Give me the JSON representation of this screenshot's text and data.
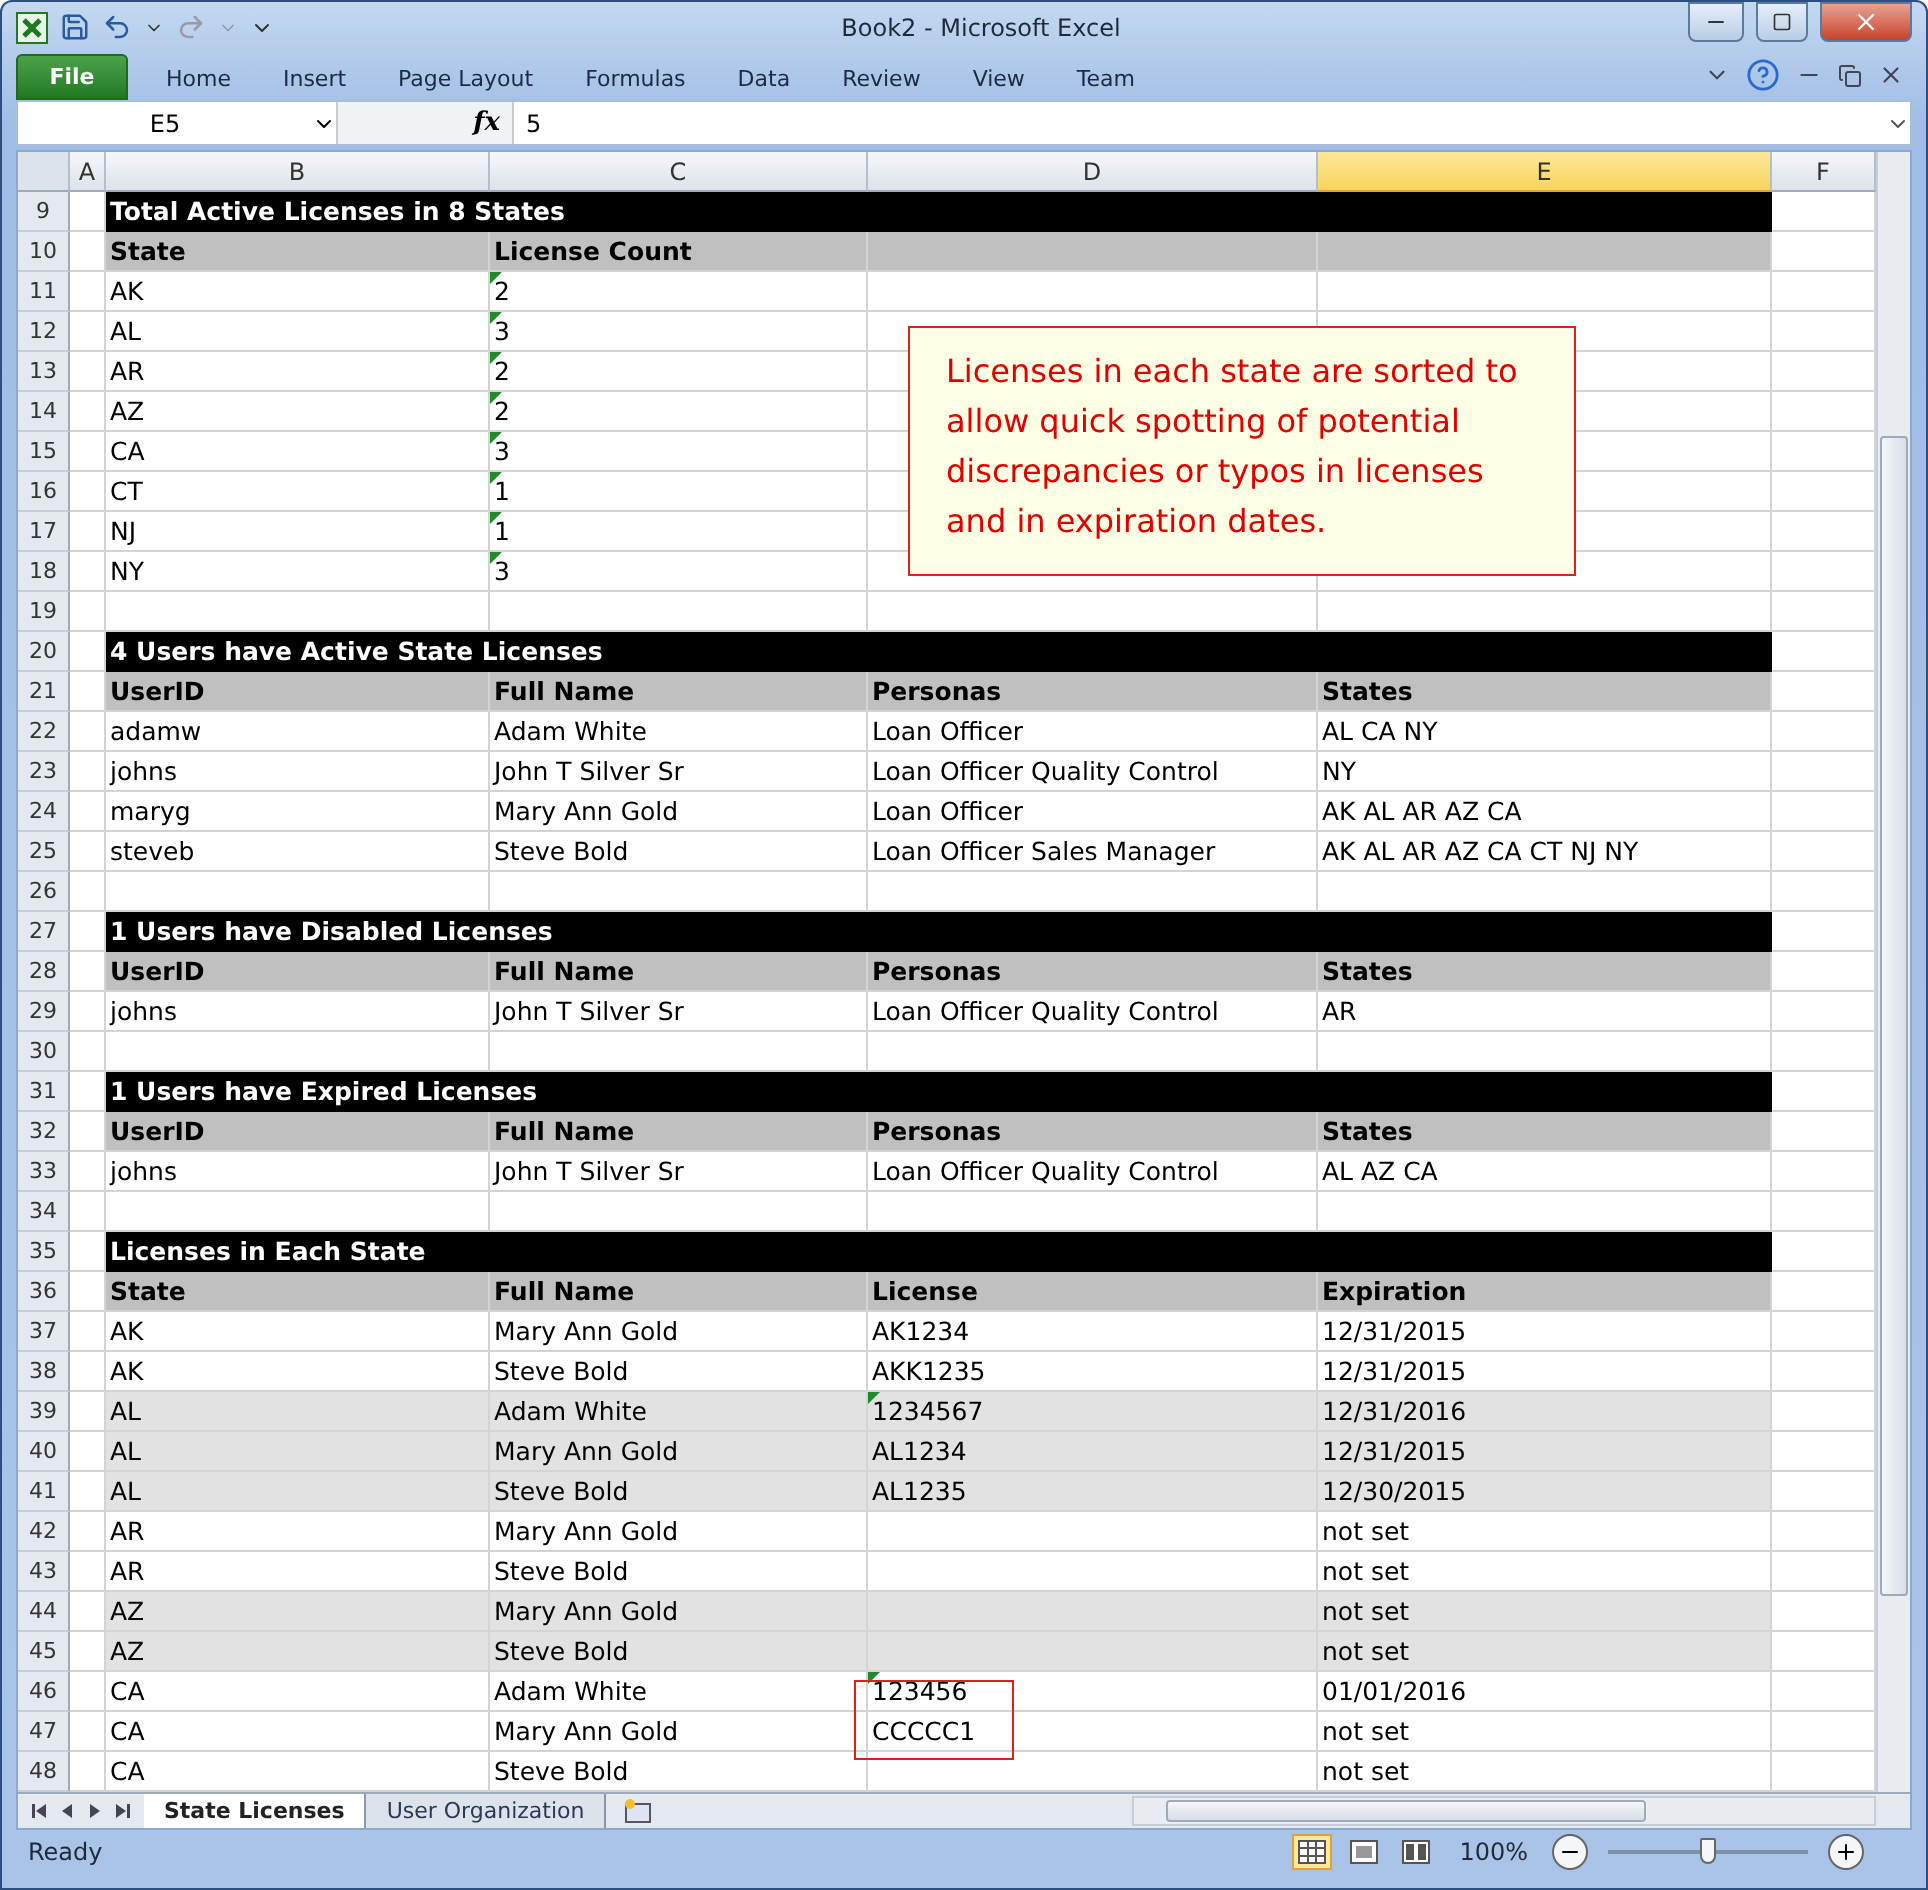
{
  "window": {
    "title": "Book2  -  Microsoft Excel"
  },
  "ribbon_tabs": [
    {
      "label": "File",
      "kind": "file"
    },
    {
      "label": "Home",
      "kind": "tab"
    },
    {
      "label": "Insert",
      "kind": "tab"
    },
    {
      "label": "Page Layout",
      "kind": "tab"
    },
    {
      "label": "Formulas",
      "kind": "tab"
    },
    {
      "label": "Data",
      "kind": "tab"
    },
    {
      "label": "Review",
      "kind": "tab"
    },
    {
      "label": "View",
      "kind": "tab"
    },
    {
      "label": "Team",
      "kind": "tab"
    }
  ],
  "formula_bar": {
    "name_box": "E5",
    "function_button": "fx",
    "formula": "5"
  },
  "columns": [
    {
      "label": "A",
      "selected": false
    },
    {
      "label": "B",
      "selected": false
    },
    {
      "label": "C",
      "selected": false
    },
    {
      "label": "D",
      "selected": false
    },
    {
      "label": "E",
      "selected": true
    },
    {
      "label": "F",
      "selected": false
    }
  ],
  "rows": [
    {
      "number": "9",
      "kind": "title",
      "title": "Total Active Licenses in 8 States"
    },
    {
      "number": "10",
      "kind": "header",
      "cells": [
        "State",
        "License Count",
        null,
        null
      ]
    },
    {
      "number": "11",
      "kind": "data",
      "shaded": false,
      "cells": [
        {
          "text": "AK"
        },
        {
          "text": "2",
          "flag": true
        },
        null,
        null
      ]
    },
    {
      "number": "12",
      "kind": "data",
      "shaded": false,
      "cells": [
        {
          "text": "AL"
        },
        {
          "text": "3",
          "flag": true
        },
        null,
        null
      ]
    },
    {
      "number": "13",
      "kind": "data",
      "shaded": false,
      "cells": [
        {
          "text": "AR"
        },
        {
          "text": "2",
          "flag": true
        },
        null,
        null
      ]
    },
    {
      "number": "14",
      "kind": "data",
      "shaded": false,
      "cells": [
        {
          "text": "AZ"
        },
        {
          "text": "2",
          "flag": true
        },
        null,
        null
      ]
    },
    {
      "number": "15",
      "kind": "data",
      "shaded": false,
      "cells": [
        {
          "text": "CA"
        },
        {
          "text": "3",
          "flag": true
        },
        null,
        null
      ]
    },
    {
      "number": "16",
      "kind": "data",
      "shaded": false,
      "cells": [
        {
          "text": "CT"
        },
        {
          "text": "1",
          "flag": true
        },
        null,
        null
      ]
    },
    {
      "number": "17",
      "kind": "data",
      "shaded": false,
      "cells": [
        {
          "text": "NJ"
        },
        {
          "text": "1",
          "flag": true
        },
        null,
        null
      ]
    },
    {
      "number": "18",
      "kind": "data",
      "shaded": false,
      "cells": [
        {
          "text": "NY"
        },
        {
          "text": "3",
          "flag": true
        },
        null,
        null
      ]
    },
    {
      "number": "19",
      "kind": "blank"
    },
    {
      "number": "20",
      "kind": "title",
      "title": "4 Users have Active State Licenses"
    },
    {
      "number": "21",
      "kind": "header",
      "cells": [
        "UserID",
        "Full Name",
        "Personas",
        "States"
      ]
    },
    {
      "number": "22",
      "kind": "data",
      "shaded": false,
      "cells": [
        {
          "text": "adamw"
        },
        {
          "text": "Adam White"
        },
        {
          "text": "Loan Officer"
        },
        {
          "text": "AL CA NY"
        }
      ]
    },
    {
      "number": "23",
      "kind": "data",
      "shaded": false,
      "cells": [
        {
          "text": "johns"
        },
        {
          "text": "John T Silver Sr"
        },
        {
          "text": "Loan Officer Quality Control"
        },
        {
          "text": "NY"
        }
      ]
    },
    {
      "number": "24",
      "kind": "data",
      "shaded": false,
      "cells": [
        {
          "text": "maryg"
        },
        {
          "text": "Mary Ann Gold"
        },
        {
          "text": "Loan Officer"
        },
        {
          "text": "AK AL AR AZ CA"
        }
      ]
    },
    {
      "number": "25",
      "kind": "data",
      "shaded": false,
      "cells": [
        {
          "text": "steveb"
        },
        {
          "text": "Steve Bold"
        },
        {
          "text": "Loan Officer Sales Manager"
        },
        {
          "text": "AK AL AR AZ CA CT NJ NY"
        }
      ]
    },
    {
      "number": "26",
      "kind": "blank"
    },
    {
      "number": "27",
      "kind": "title",
      "title": "1 Users have Disabled Licenses"
    },
    {
      "number": "28",
      "kind": "header",
      "cells": [
        "UserID",
        "Full Name",
        "Personas",
        "States"
      ]
    },
    {
      "number": "29",
      "kind": "data",
      "shaded": false,
      "cells": [
        {
          "text": "johns"
        },
        {
          "text": "John T Silver Sr"
        },
        {
          "text": "Loan Officer Quality Control"
        },
        {
          "text": "AR"
        }
      ]
    },
    {
      "number": "30",
      "kind": "blank"
    },
    {
      "number": "31",
      "kind": "title",
      "title": "1 Users have Expired Licenses"
    },
    {
      "number": "32",
      "kind": "header",
      "cells": [
        "UserID",
        "Full Name",
        "Personas",
        "States"
      ]
    },
    {
      "number": "33",
      "kind": "data",
      "shaded": false,
      "cells": [
        {
          "text": "johns"
        },
        {
          "text": "John T Silver Sr"
        },
        {
          "text": "Loan Officer Quality Control"
        },
        {
          "text": "AL AZ CA"
        }
      ]
    },
    {
      "number": "34",
      "kind": "blank"
    },
    {
      "number": "35",
      "kind": "title",
      "title": "Licenses in Each State"
    },
    {
      "number": "36",
      "kind": "header",
      "cells": [
        "State",
        "Full Name",
        "License",
        "Expiration"
      ]
    },
    {
      "number": "37",
      "kind": "data",
      "shaded": false,
      "cells": [
        {
          "text": "AK"
        },
        {
          "text": "Mary Ann Gold"
        },
        {
          "text": "AK1234"
        },
        {
          "text": "12/31/2015"
        }
      ]
    },
    {
      "number": "38",
      "kind": "data",
      "shaded": false,
      "cells": [
        {
          "text": "AK"
        },
        {
          "text": "Steve Bold"
        },
        {
          "text": "AKK1235"
        },
        {
          "text": "12/31/2015"
        }
      ]
    },
    {
      "number": "39",
      "kind": "data",
      "shaded": true,
      "cells": [
        {
          "text": "AL"
        },
        {
          "text": "Adam White"
        },
        {
          "text": "1234567",
          "flag": true
        },
        {
          "text": "12/31/2016"
        }
      ]
    },
    {
      "number": "40",
      "kind": "data",
      "shaded": true,
      "cells": [
        {
          "text": "AL"
        },
        {
          "text": "Mary Ann Gold"
        },
        {
          "text": "AL1234"
        },
        {
          "text": "12/31/2015"
        }
      ]
    },
    {
      "number": "41",
      "kind": "data",
      "shaded": true,
      "cells": [
        {
          "text": "AL"
        },
        {
          "text": "Steve Bold"
        },
        {
          "text": "AL1235"
        },
        {
          "text": "12/30/2015"
        }
      ]
    },
    {
      "number": "42",
      "kind": "data",
      "shaded": false,
      "cells": [
        {
          "text": "AR"
        },
        {
          "text": "Mary Ann Gold"
        },
        null,
        {
          "text": "not set"
        }
      ]
    },
    {
      "number": "43",
      "kind": "data",
      "shaded": false,
      "cells": [
        {
          "text": "AR"
        },
        {
          "text": "Steve Bold"
        },
        null,
        {
          "text": "not set"
        }
      ]
    },
    {
      "number": "44",
      "kind": "data",
      "shaded": true,
      "cells": [
        {
          "text": "AZ"
        },
        {
          "text": "Mary Ann Gold"
        },
        null,
        {
          "text": "not set"
        }
      ]
    },
    {
      "number": "45",
      "kind": "data",
      "shaded": true,
      "cells": [
        {
          "text": "AZ"
        },
        {
          "text": "Steve Bold"
        },
        null,
        {
          "text": "not set"
        }
      ]
    },
    {
      "number": "46",
      "kind": "data",
      "shaded": false,
      "cells": [
        {
          "text": "CA"
        },
        {
          "text": "Adam White"
        },
        {
          "text": "123456",
          "flag": true,
          "boxed": true
        },
        {
          "text": "01/01/2016"
        }
      ]
    },
    {
      "number": "47",
      "kind": "data",
      "shaded": false,
      "cells": [
        {
          "text": "CA"
        },
        {
          "text": "Mary Ann Gold"
        },
        {
          "text": "CCCCC1",
          "boxed": true
        },
        {
          "text": "not set"
        }
      ]
    },
    {
      "number": "48",
      "kind": "data",
      "shaded": false,
      "cells": [
        {
          "text": "CA"
        },
        {
          "text": "Steve Bold"
        },
        null,
        {
          "text": "not set"
        }
      ]
    }
  ],
  "callout": {
    "text": "Licenses in each state are sorted to allow quick spotting of potential discrepancies or typos in licenses and in expiration dates."
  },
  "sheet_tabs": [
    {
      "label": "State Licenses",
      "selected": true
    },
    {
      "label": "User Organization",
      "selected": false
    }
  ],
  "status_bar": {
    "status": "Ready",
    "views": [
      {
        "kind": "normal",
        "selected": true
      },
      {
        "kind": "layout",
        "selected": false
      },
      {
        "kind": "break",
        "selected": false
      }
    ],
    "zoom": "100%",
    "zoom_slider": {
      "level": 0.5
    }
  }
}
